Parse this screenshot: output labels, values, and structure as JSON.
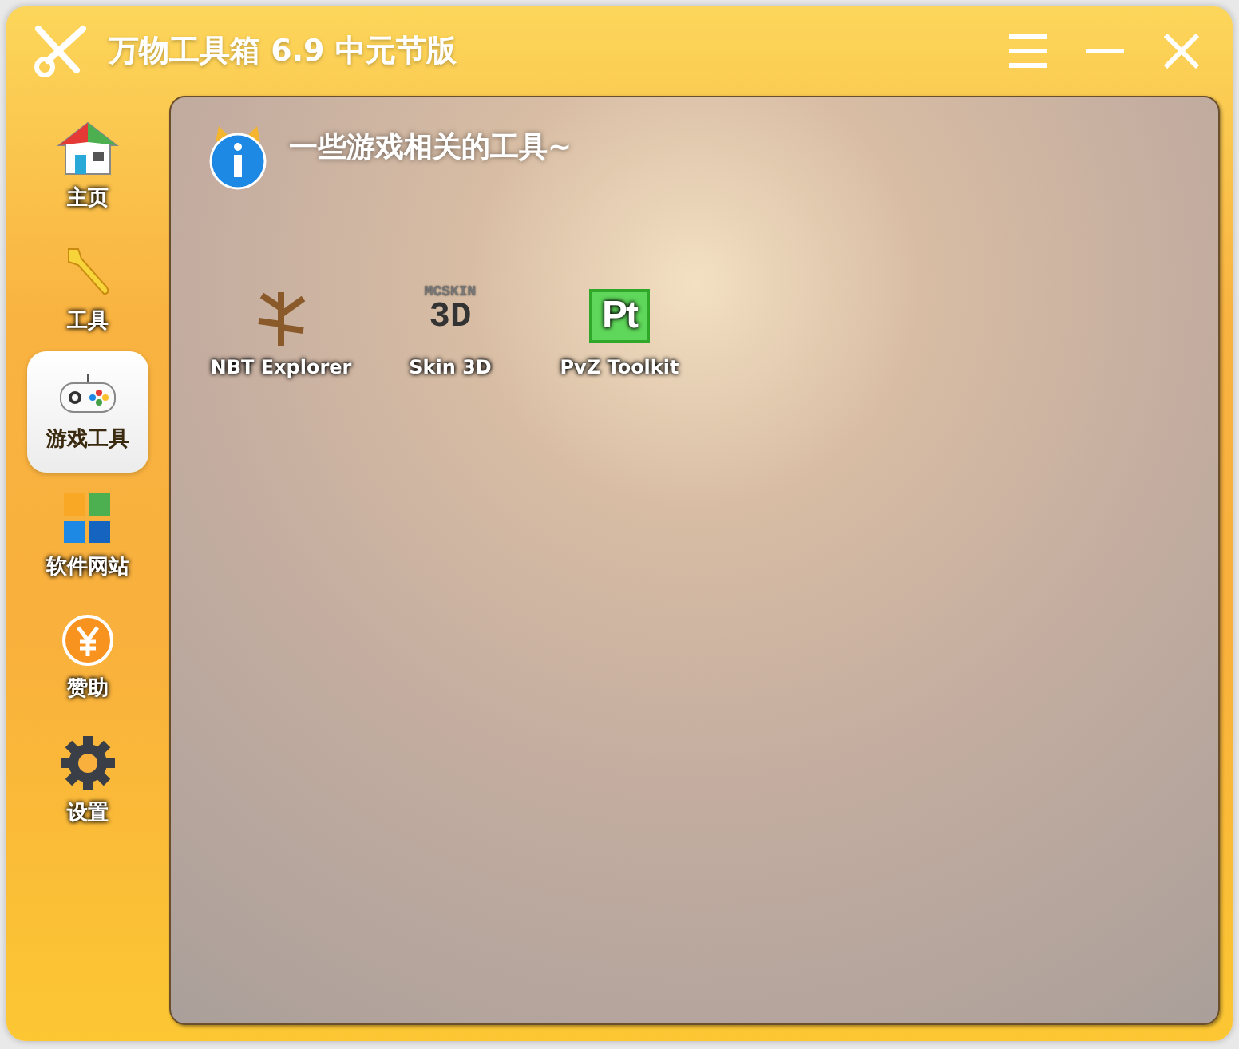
{
  "window": {
    "title": "万物工具箱 6.9 中元节版"
  },
  "sidebar": {
    "items": [
      {
        "kind": "home",
        "label": "主页",
        "selected": false
      },
      {
        "kind": "wrench",
        "label": "工具",
        "selected": false
      },
      {
        "kind": "gamepad",
        "label": "游戏工具",
        "selected": true
      },
      {
        "kind": "windows",
        "label": "软件网站",
        "selected": false
      },
      {
        "kind": "coin",
        "label": "赞助",
        "selected": false
      },
      {
        "kind": "gear",
        "label": "设置",
        "selected": false
      }
    ]
  },
  "panel": {
    "heading": "一些游戏相关的工具~",
    "tools": [
      {
        "kind": "tree",
        "name": "NBT Explorer"
      },
      {
        "kind": "skin",
        "name": "Skin 3D",
        "logo_text": [
          "MCSKIN",
          "3D"
        ]
      },
      {
        "kind": "pt",
        "name": "PvZ Toolkit",
        "logo_text": [
          "Pt"
        ]
      }
    ]
  }
}
